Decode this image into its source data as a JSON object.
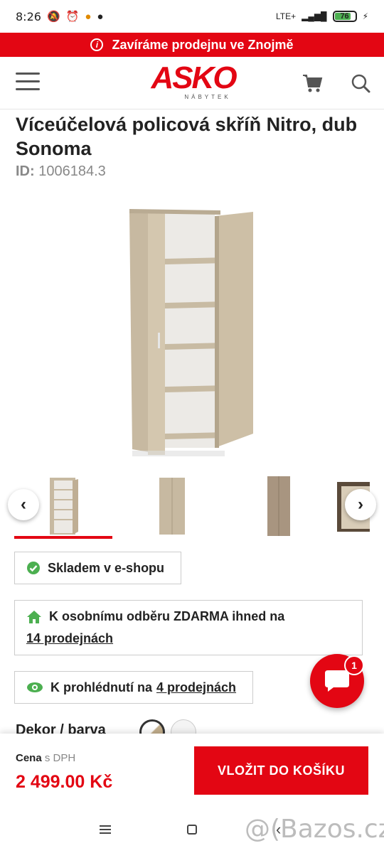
{
  "status_bar": {
    "time": "8:26",
    "network": "LTE+",
    "battery": "76"
  },
  "banner": {
    "text": "Zavíráme prodejnu ve Znojmě",
    "color": "#e30613"
  },
  "header": {
    "logo_text": "ASKO",
    "logo_sub": "NÁBYTEK"
  },
  "product": {
    "title": "Víceúčelová policová skříň Nitro, dub Sonoma",
    "id_label": "ID:",
    "id_value": "1006184.3"
  },
  "availability": {
    "stock": "Skladem v e-shopu",
    "pickup_text": "K osobnímu odběru ZDARMA ihned na",
    "pickup_link": "14 prodejnách",
    "view_text": "K prohlédnutí na",
    "view_link": "4 prodejnách"
  },
  "options": {
    "dekor_label": "Dekor / barva"
  },
  "chat": {
    "badge": "1"
  },
  "purchase": {
    "price_label": "Cena",
    "price_suffix": "s DPH",
    "price": "2 499.00 Kč",
    "add_to_cart": "VLOŽIT DO KOŠÍKU"
  },
  "watermark": "@(Bazos.cz",
  "colors": {
    "accent": "#e30613",
    "ok": "#4caf50"
  }
}
